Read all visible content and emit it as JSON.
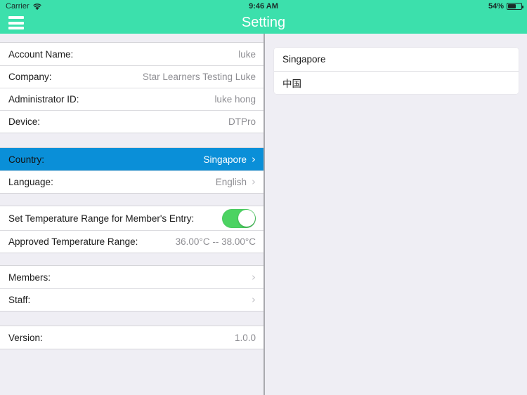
{
  "status_bar": {
    "carrier": "Carrier",
    "wifi_icon": "wifi-icon",
    "time": "9:46 AM",
    "battery_percent": "54%",
    "battery_icon": "battery-icon"
  },
  "nav_bar": {
    "menu_icon": "hamburger-menu-icon",
    "title": "Setting"
  },
  "settings": {
    "group_account": [
      {
        "label": "Account Name:",
        "value": "luke"
      },
      {
        "label": "Company:",
        "value": "Star Learners Testing Luke"
      },
      {
        "label": "Administrator ID:",
        "value": "luke hong"
      },
      {
        "label": "Device:",
        "value": "DTPro"
      }
    ],
    "group_locale": [
      {
        "label": "Country:",
        "value": "Singapore",
        "chevron": "›",
        "selected": true
      },
      {
        "label": "Language:",
        "value": "English",
        "chevron": "›",
        "selected": false
      }
    ],
    "group_temperature": {
      "toggle_label": "Set Temperature Range for Member's Entry:",
      "toggle_state": "on",
      "range_label": "Approved Temperature Range:",
      "range_value": "36.00°C -- 38.00°C"
    },
    "group_people": [
      {
        "label": "Members:",
        "chevron": "›"
      },
      {
        "label": "Staff:",
        "chevron": "›"
      }
    ],
    "group_version": [
      {
        "label": "Version:",
        "value": "1.0.0"
      }
    ]
  },
  "country_picker": {
    "options": [
      {
        "label": "Singapore"
      },
      {
        "label": "中国"
      }
    ]
  },
  "colors": {
    "nav_green": "#3ce0ac",
    "selection_blue": "#0a8fd8",
    "toggle_green": "#4cd362",
    "background": "#efeef4",
    "value_gray": "#8e8e93"
  }
}
